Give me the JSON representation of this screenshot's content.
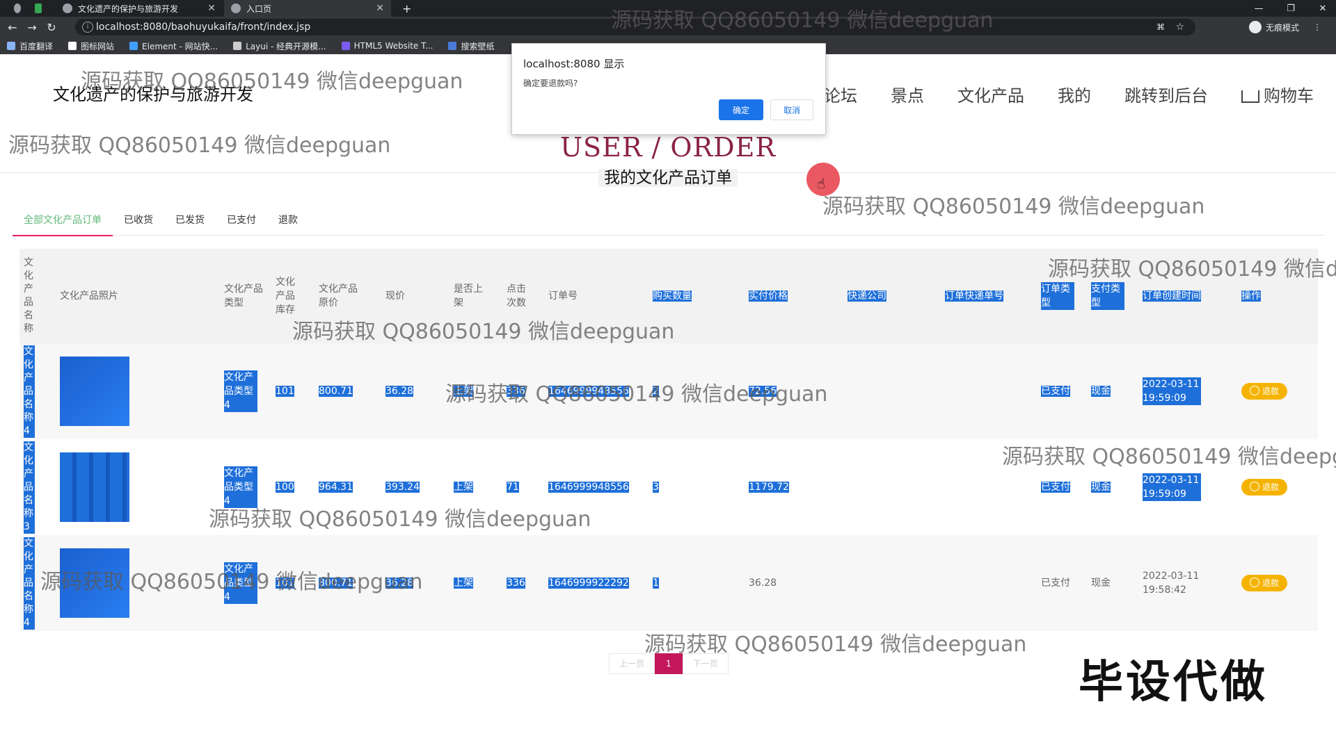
{
  "browser": {
    "tabs": [
      {
        "label": "文化遗产的保护与旅游开发",
        "active": false
      },
      {
        "label": "入口页",
        "active": true
      }
    ],
    "url": "localhost:8080/baohuyukaifa/front/index.jsp",
    "profile_label": "无痕模式",
    "bookmarks": [
      "百度翻译",
      "图标网站",
      "Element - 网站快...",
      "Layui - 经典开源模...",
      "HTML5 Website T...",
      "搜索壁纸"
    ]
  },
  "header": {
    "site_title": "文化遗产的保护与旅游开发",
    "nav": [
      "论坛",
      "景点",
      "文化产品",
      "我的",
      "跳转到后台",
      "购物车"
    ]
  },
  "section": {
    "title": "USER / ORDER",
    "subtitle": "我的文化产品订单"
  },
  "order_tabs": [
    "全部文化产品订单",
    "已收货",
    "已发货",
    "已支付",
    "退款"
  ],
  "table": {
    "headers": [
      "文化产品名称",
      "文化产品照片",
      "文化产品类型",
      "文化产品库存",
      "文化产品原价",
      "现价",
      "是否上架",
      "点击次数",
      "订单号",
      "购买数量",
      "实付价格",
      "快递公司",
      "订单快递单号",
      "订单类型",
      "支付类型",
      "订单创建时间",
      "操作"
    ],
    "rows": [
      {
        "name": "文化产品名称4",
        "type": "文化产品类型4",
        "stock": "101",
        "orig_price": "800.71",
        "price": "36.28",
        "on_shelf": "上架",
        "clicks": "336",
        "order_no": "1646999948556",
        "qty": "2",
        "paid": "72.56",
        "express": "",
        "tracking": "",
        "order_type": "已支付",
        "pay_type": "现金",
        "created": "2022-03-11 19:59:09",
        "action": "退款"
      },
      {
        "name": "文化产品名称3",
        "type": "文化产品类型4",
        "stock": "100",
        "orig_price": "964.31",
        "price": "393.24",
        "on_shelf": "上架",
        "clicks": "71",
        "order_no": "1646999948556",
        "qty": "3",
        "paid": "1179.72",
        "express": "",
        "tracking": "",
        "order_type": "已支付",
        "pay_type": "现金",
        "created": "2022-03-11 19:59:09",
        "action": "退款"
      },
      {
        "name": "文化产品名称4",
        "type": "文化产品类型4",
        "stock": "101",
        "orig_price": "800.71",
        "price": "36.28",
        "on_shelf": "上架",
        "clicks": "336",
        "order_no": "1646999922292",
        "qty": "1",
        "paid": "36.28",
        "express": "",
        "tracking": "",
        "order_type": "已支付",
        "pay_type": "现金",
        "created": "2022-03-11 19:58:42",
        "action": "退款"
      }
    ]
  },
  "pager": {
    "prev": "上一页",
    "current": "1",
    "next": "下一页"
  },
  "dialog": {
    "title": "localhost:8080 显示",
    "message": "确定要退款吗?",
    "ok": "确定",
    "cancel": "取消"
  },
  "watermark": "源码获取 QQ86050149 微信deepguan",
  "brand_stamp": "毕设代做",
  "colors": {
    "accent": "#8b2346",
    "tab_active": "#5fb878",
    "selection": "#1e6fd9",
    "refund": "#f5b300",
    "pager_current": "#c2185b"
  }
}
